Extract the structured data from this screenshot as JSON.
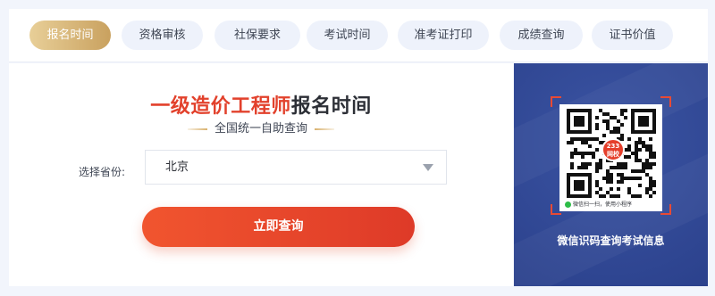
{
  "tabs": [
    {
      "label": "报名时间",
      "active": true
    },
    {
      "label": "资格审核",
      "active": false
    },
    {
      "label": "社保要求",
      "active": false
    },
    {
      "label": "考试时间",
      "active": false
    },
    {
      "label": "准考证打印",
      "active": false
    },
    {
      "label": "成绩查询",
      "active": false
    },
    {
      "label": "证书价值",
      "active": false
    }
  ],
  "main": {
    "title_accent": "一级造价工程师",
    "title_rest": "报名时间",
    "subtitle": "全国统一自助查询",
    "province_label": "选择省份:",
    "province_value": "北京",
    "submit_label": "立即查询"
  },
  "qr": {
    "logo_line1": "233",
    "logo_line2": "网校",
    "caption": "微信扫一扫，使用小程序",
    "info": "微信识码查询考试信息"
  },
  "colors": {
    "active_tab": "#d4b072",
    "accent": "#e2412c",
    "panel": "#2f4690"
  }
}
